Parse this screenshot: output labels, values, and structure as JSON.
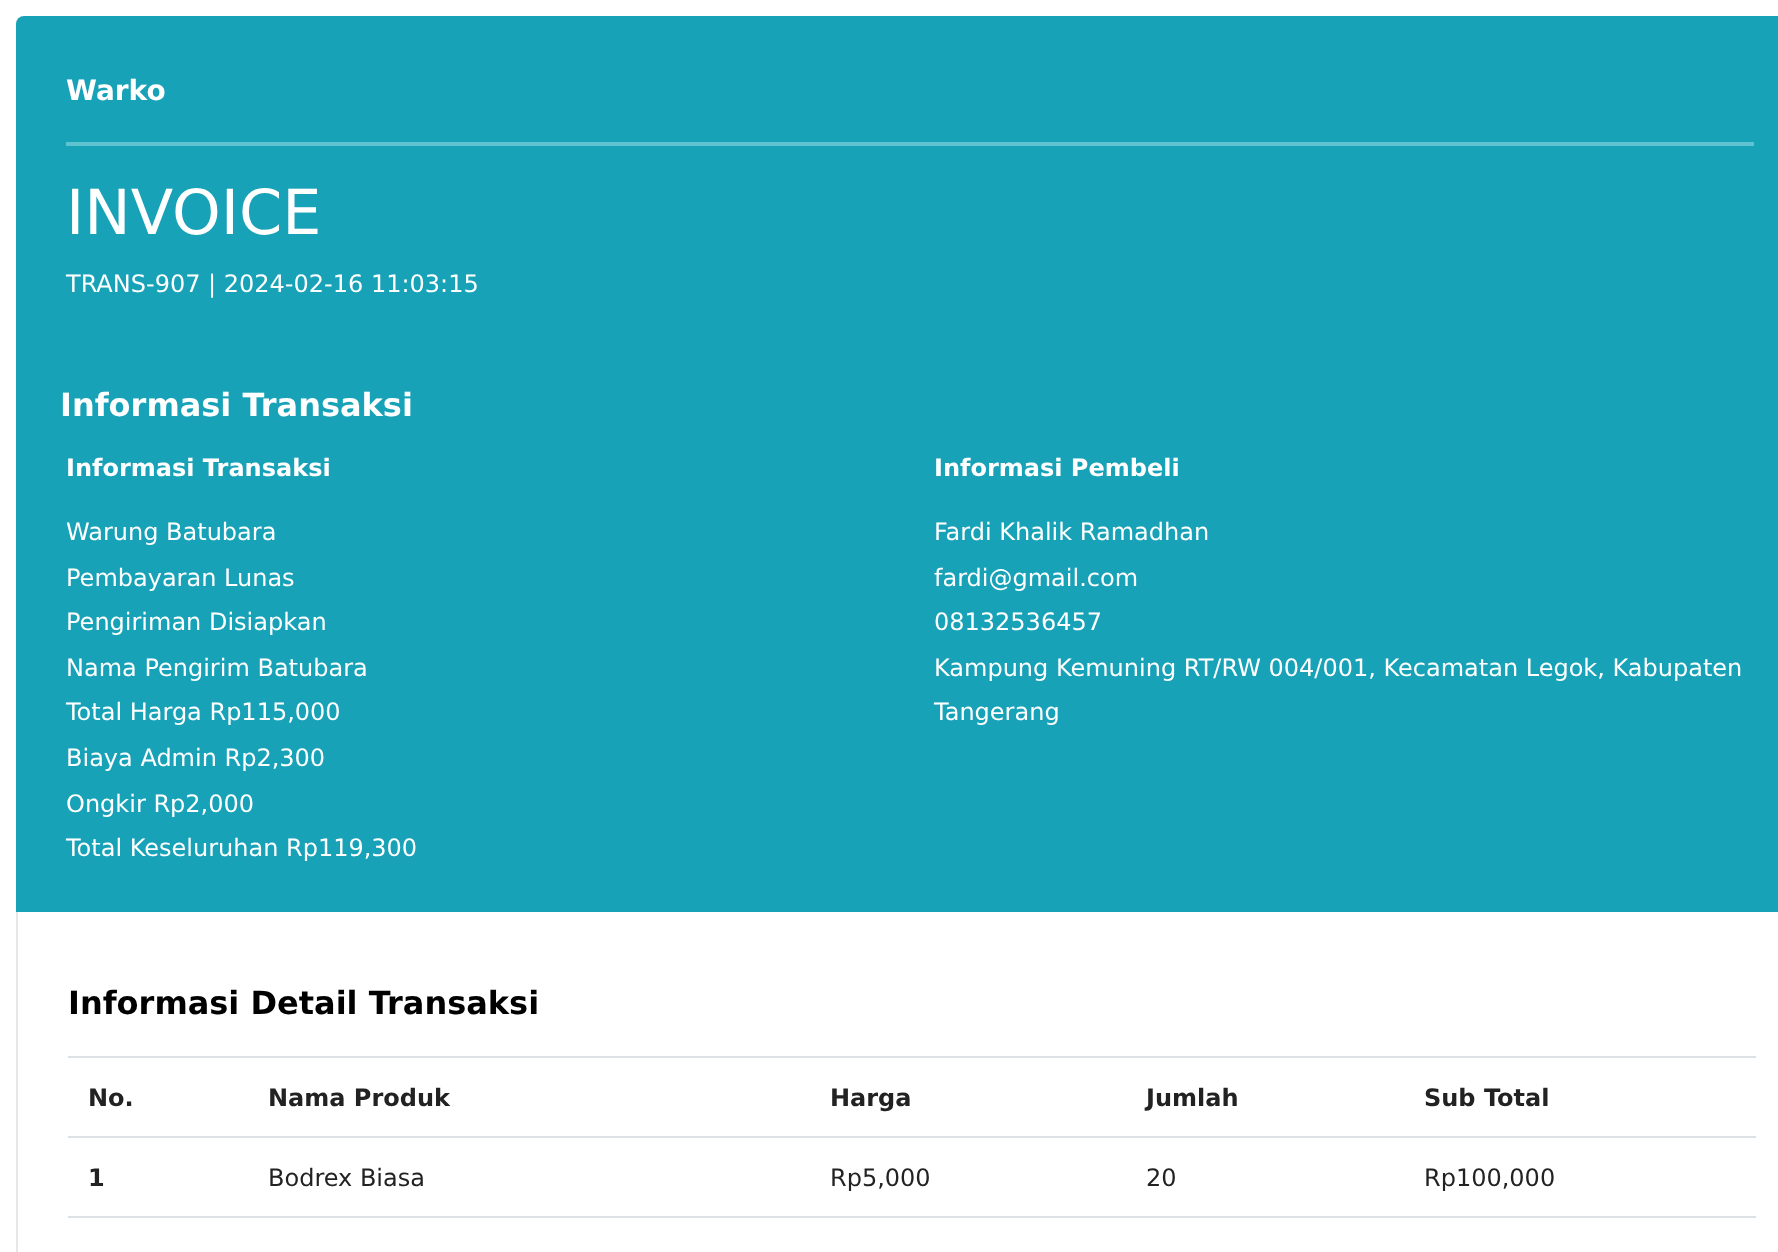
{
  "brand": "Warko",
  "title": "INVOICE",
  "subtitle": "TRANS-907 | 2024-02-16 11:03:15",
  "section_title": "Informasi Transaksi",
  "columns": [
    {
      "heading": "Informasi Transaksi",
      "lines": [
        "Warung Batubara",
        "Pembayaran Lunas",
        "Pengiriman Disiapkan",
        "Nama Pengirim Batubara",
        "Total Harga Rp115,000",
        "Biaya Admin Rp2,300",
        "Ongkir Rp2,000",
        "Total Keseluruhan Rp119,300"
      ]
    },
    {
      "heading": "Informasi Pembeli",
      "lines": [
        "Fardi Khalik Ramadhan",
        "fardi@gmail.com",
        "08132536457",
        "Kampung Kemuning RT/RW 004/001, Kecamatan Legok, Kabupaten Tangerang"
      ]
    }
  ],
  "detail_title": "Informasi Detail Transaksi",
  "table": {
    "columns": [
      "No.",
      "Nama Produk",
      "Harga",
      "Jumlah",
      "Sub Total"
    ],
    "rows": [
      [
        "1",
        "Bodrex Biasa",
        "Rp5,000",
        "20",
        "Rp100,000"
      ]
    ]
  }
}
